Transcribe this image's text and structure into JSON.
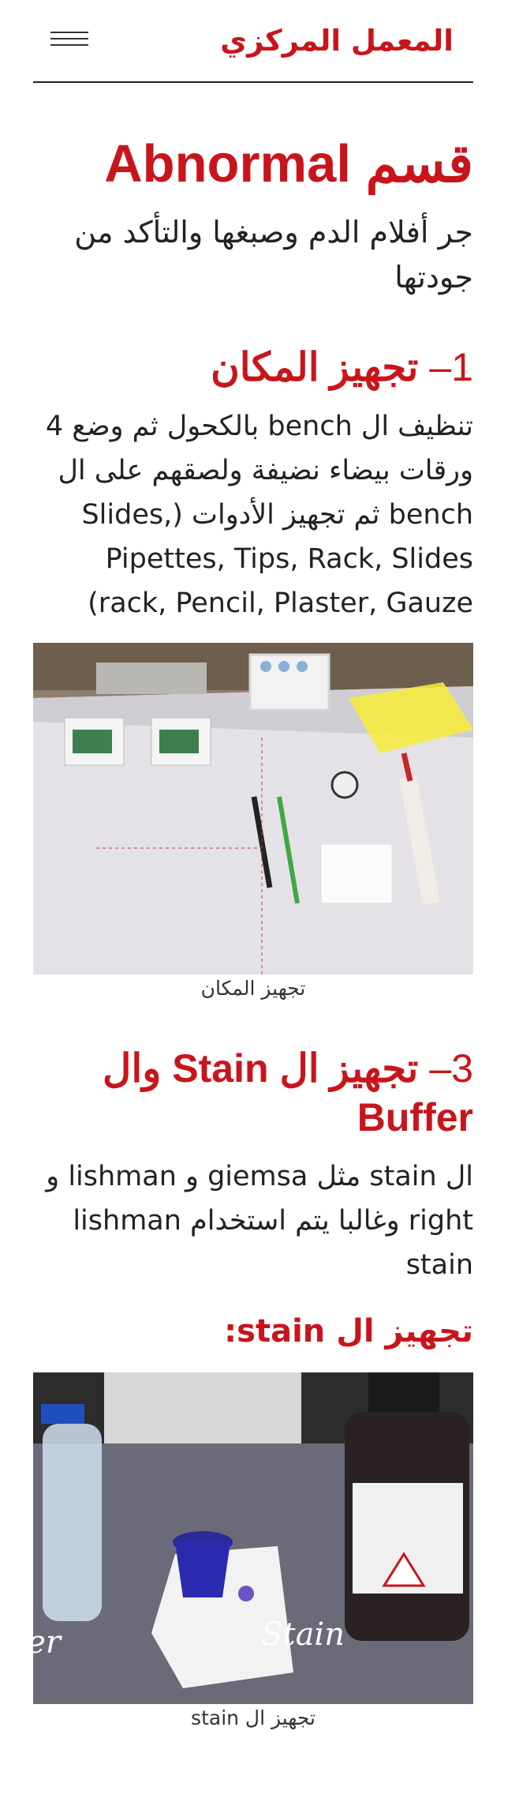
{
  "header": {
    "site_title": "المعمل المركزي"
  },
  "section": {
    "title": "قسم Abnormal",
    "intro": "جر أفلام الدم وصبغها والتأكد من جودتها"
  },
  "step1": {
    "heading_num": "1–",
    "heading_text": "تجهيز المكان",
    "paragraph": "تنظيف ال bench بالكحول ثم وضع 4 ورقات بيضاء نضيفة ولصقهم على ال bench ثم تجهيز الأدوات (,Slides Pipettes, Tips, Rack, Slides (rack, Pencil, Plaster, Gauze",
    "figure_caption": "تجهيز المكان"
  },
  "step3": {
    "heading_num": "3–",
    "heading_text": "تجهيز ال Stain وال Buffer",
    "paragraph": "ال stain مثل giemsa و lishman و right وغالبا يتم استخدام lishman stain",
    "subheading": "تجهيز ال stain:",
    "figure_caption": "تجهيز ال stain",
    "photo_labels": {
      "left": "Buffer",
      "right": "Stain"
    }
  },
  "colors": {
    "accent": "#c8151b",
    "text": "#222222"
  }
}
